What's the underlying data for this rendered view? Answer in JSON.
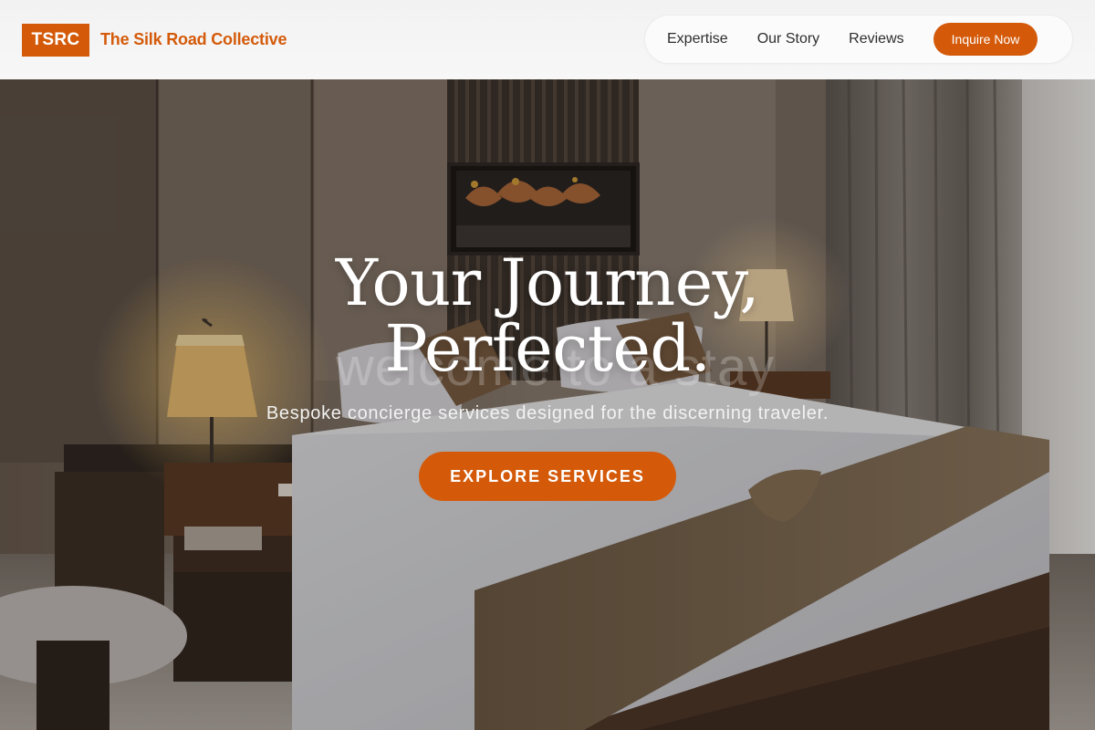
{
  "header": {
    "logo_text": "TSRC",
    "brand_name": "The Silk Road Collective",
    "nav": [
      {
        "label": "Expertise"
      },
      {
        "label": "Our Story"
      },
      {
        "label": "Reviews"
      }
    ],
    "cta_label": "Inquire Now"
  },
  "hero": {
    "title_line1": "Your Journey,",
    "title_line2": "Perfected.",
    "ghost_text": "welcome to a stay",
    "subtitle": "Bespoke concierge services designed for the discerning traveler.",
    "cta_label": "EXPLORE SERVICES",
    "background": "hotel-bedroom-photo"
  },
  "colors": {
    "accent": "#d45a0a",
    "header_bg": "#f4f4f4",
    "text_dark": "#2d2d2d"
  }
}
